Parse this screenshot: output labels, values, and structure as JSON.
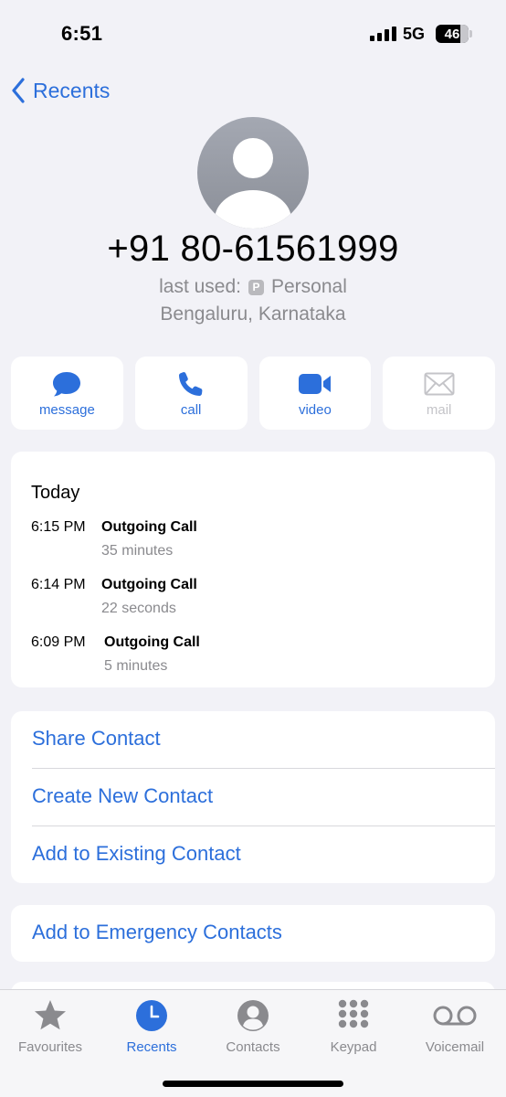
{
  "status_bar": {
    "time": "6:51",
    "network": "5G",
    "battery": "46"
  },
  "nav": {
    "back_label": "Recents"
  },
  "contact": {
    "phone_number": "+91 80-61561999",
    "last_used_label": "last used:",
    "line_badge": "P",
    "line_name": "Personal",
    "location": "Bengaluru, Karnataka"
  },
  "actions": [
    {
      "label": "message",
      "icon": "message-bubble-icon",
      "enabled": true
    },
    {
      "label": "call",
      "icon": "phone-icon",
      "enabled": true
    },
    {
      "label": "video",
      "icon": "video-camera-icon",
      "enabled": true
    },
    {
      "label": "mail",
      "icon": "envelope-icon",
      "enabled": false
    }
  ],
  "history": {
    "title": "Today",
    "calls": [
      {
        "time": "6:15 PM",
        "type": "Outgoing Call",
        "duration": "35 minutes"
      },
      {
        "time": "6:14 PM",
        "type": "Outgoing Call",
        "duration": "22 seconds"
      },
      {
        "time": "6:09 PM",
        "type": "Outgoing Call",
        "duration": "5 minutes"
      }
    ]
  },
  "options": {
    "share": "Share Contact",
    "create": "Create New Contact",
    "add_existing": "Add to Existing Contact",
    "emergency": "Add to Emergency Contacts"
  },
  "tabs": [
    {
      "label": "Favourites",
      "icon": "star-icon",
      "active": false
    },
    {
      "label": "Recents",
      "icon": "clock-icon",
      "active": true
    },
    {
      "label": "Contacts",
      "icon": "person-circle-icon",
      "active": false
    },
    {
      "label": "Keypad",
      "icon": "keypad-icon",
      "active": false
    },
    {
      "label": "Voicemail",
      "icon": "voicemail-icon",
      "active": false
    }
  ],
  "colors": {
    "accent": "#2c6fdb",
    "secondary_text": "#8a8a8e",
    "background": "#f2f2f7"
  }
}
